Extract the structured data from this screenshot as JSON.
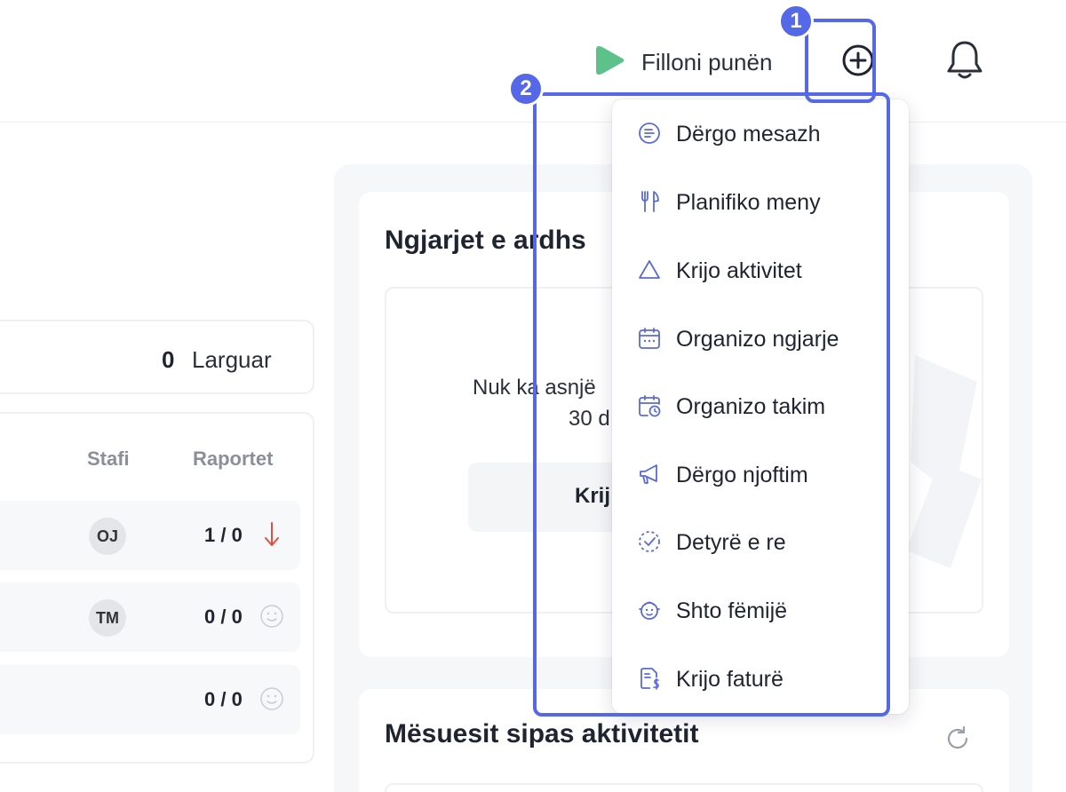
{
  "header": {
    "start_work_label": "Filloni punën"
  },
  "stats": {
    "larguar_count": "0",
    "larguar_label": "Larguar"
  },
  "table": {
    "columns": [
      "Stafi",
      "Raportet"
    ],
    "rows": [
      {
        "initials": "OJ",
        "reports": "1 / 0",
        "trend": "down-arrow-icon"
      },
      {
        "initials": "TM",
        "reports": "0 / 0",
        "trend": "smile-icon"
      },
      {
        "initials": "",
        "reports": "0 / 0",
        "trend": "smile-icon"
      }
    ]
  },
  "events": {
    "title": "Ngjarjet e ardhs",
    "empty_line1": "Nuk ka asnjë",
    "empty_line2": "30 d",
    "create_label": "Krij"
  },
  "teachers": {
    "title": "Mësuesit sipas aktivitetit"
  },
  "dropdown": {
    "items": [
      {
        "label": "Dërgo mesazh",
        "icon": "message-icon"
      },
      {
        "label": "Planifiko meny",
        "icon": "fork-knife-icon"
      },
      {
        "label": "Krijo aktivitet",
        "icon": "triangle-icon"
      },
      {
        "label": "Organizo ngjarje",
        "icon": "calendar-icon"
      },
      {
        "label": "Organizo takim",
        "icon": "calendar-clock-icon"
      },
      {
        "label": "Dërgo njoftim",
        "icon": "megaphone-icon"
      },
      {
        "label": "Detyrë e re",
        "icon": "dashed-check-icon"
      },
      {
        "label": "Shto fëmijë",
        "icon": "child-face-icon"
      },
      {
        "label": "Krijo faturë",
        "icon": "invoice-icon"
      }
    ]
  },
  "annotations": {
    "badge1": "1",
    "badge2": "2"
  },
  "colors": {
    "accent": "#5468e8",
    "play_green": "#5cc28a",
    "icon_blue": "#5a6bd6",
    "trend_red": "#e0503c"
  }
}
